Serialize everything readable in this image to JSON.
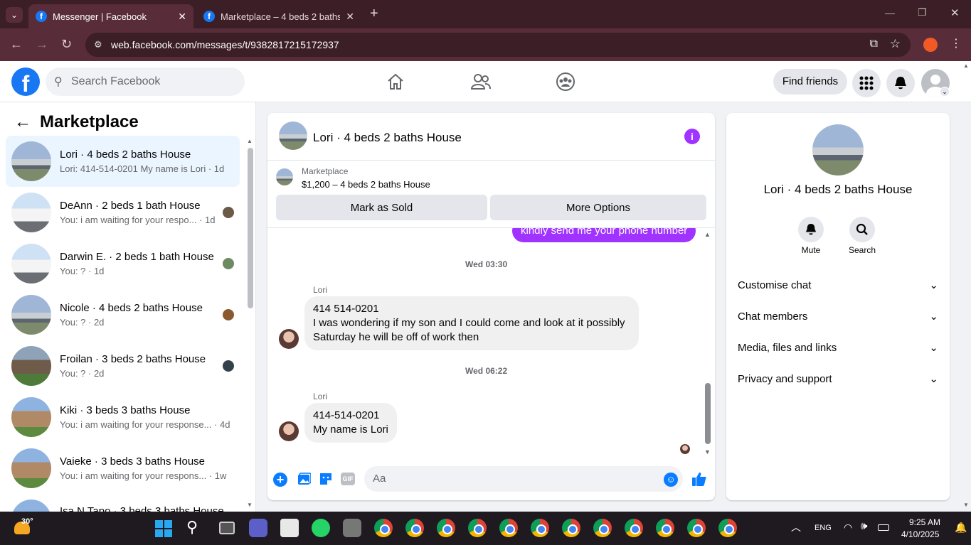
{
  "browser": {
    "tabs": [
      {
        "title": "Messenger | Facebook"
      },
      {
        "title": "Marketplace – 4 beds 2 baths H"
      }
    ],
    "url": "web.facebook.com/messages/t/9382817215172937"
  },
  "header": {
    "search_placeholder": "Search Facebook",
    "find_friends": "Find friends"
  },
  "sidebar": {
    "title": "Marketplace",
    "conversations": [
      {
        "title": "Lori · 4 beds 2 baths House",
        "preview": "Lori: 414-514-0201 My name is Lori · 1d"
      },
      {
        "title": "DeAnn · 2 beds 1 bath House",
        "preview": "You: i am waiting for your respo... · 1d"
      },
      {
        "title": "Darwin E. · 2 beds 1 bath House",
        "preview": "You: ? · 1d"
      },
      {
        "title": "Nicole · 4 beds 2 baths House",
        "preview": "You: ? · 2d"
      },
      {
        "title": "Froilan · 3 beds 2 baths House",
        "preview": "You: ? · 2d"
      },
      {
        "title": "Kiki · 3 beds 3 baths House",
        "preview": "You: i am waiting for your response... · 4d"
      },
      {
        "title": "Vaieke · 3 beds 3 baths House",
        "preview": "You: i am waiting for your respons... · 1w"
      },
      {
        "title": "Isa N Tapo · 3 beds 3 baths House",
        "preview": ""
      }
    ]
  },
  "chat": {
    "title": "Lori · 4 beds 2 baths House",
    "listing_source": "Marketplace",
    "listing_price": "$1,200 – 4 beds 2 baths House",
    "mark_sold": "Mark as Sold",
    "more_options": "More Options",
    "outgoing_partial": "kindly send me your phone number",
    "stamp1": "Wed 03:30",
    "sender1": "Lori",
    "msg1_line1": "414 514-0201",
    "msg1_line2": "I was wondering if my son and I could come and look at it possibly",
    "msg1_line3": "Saturday he will be off of work then",
    "stamp2": "Wed 06:22",
    "sender2": "Lori",
    "msg2_line1": "414-514-0201",
    "msg2_line2": "My name is Lori",
    "composer_placeholder": "Aa"
  },
  "info": {
    "title": "Lori · 4 beds 2 baths House",
    "mute": "Mute",
    "search": "Search",
    "sections": [
      "Customise chat",
      "Chat members",
      "Media, files and links",
      "Privacy and support"
    ]
  },
  "taskbar": {
    "weather": "30°",
    "lang": "ENG",
    "time": "9:25 AM",
    "date": "4/10/2025"
  },
  "colors": {
    "accent": "#1877f2",
    "messenger_purple": "#a033ff"
  }
}
